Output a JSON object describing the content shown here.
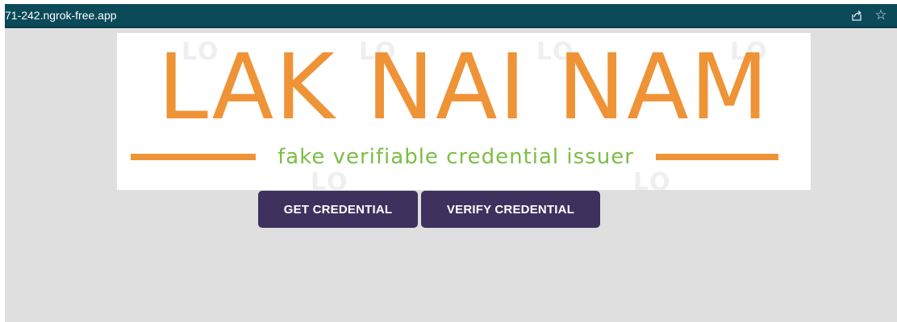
{
  "browser": {
    "url": "71-242.ngrok-free.app",
    "icons": [
      "share-icon",
      "star-icon"
    ]
  },
  "logo": {
    "title": "LAK NAI NAM",
    "subtitle": "fake verifiable credential issuer",
    "colors": {
      "title": "#ef9337",
      "subtitle": "#7dbd45"
    }
  },
  "actions": {
    "get_label": "GET CREDENTIAL",
    "verify_label": "VERIFY CREDENTIAL"
  },
  "colors": {
    "topbar": "#0b4a58",
    "button": "#3e315e",
    "background": "#dfdfdf"
  }
}
